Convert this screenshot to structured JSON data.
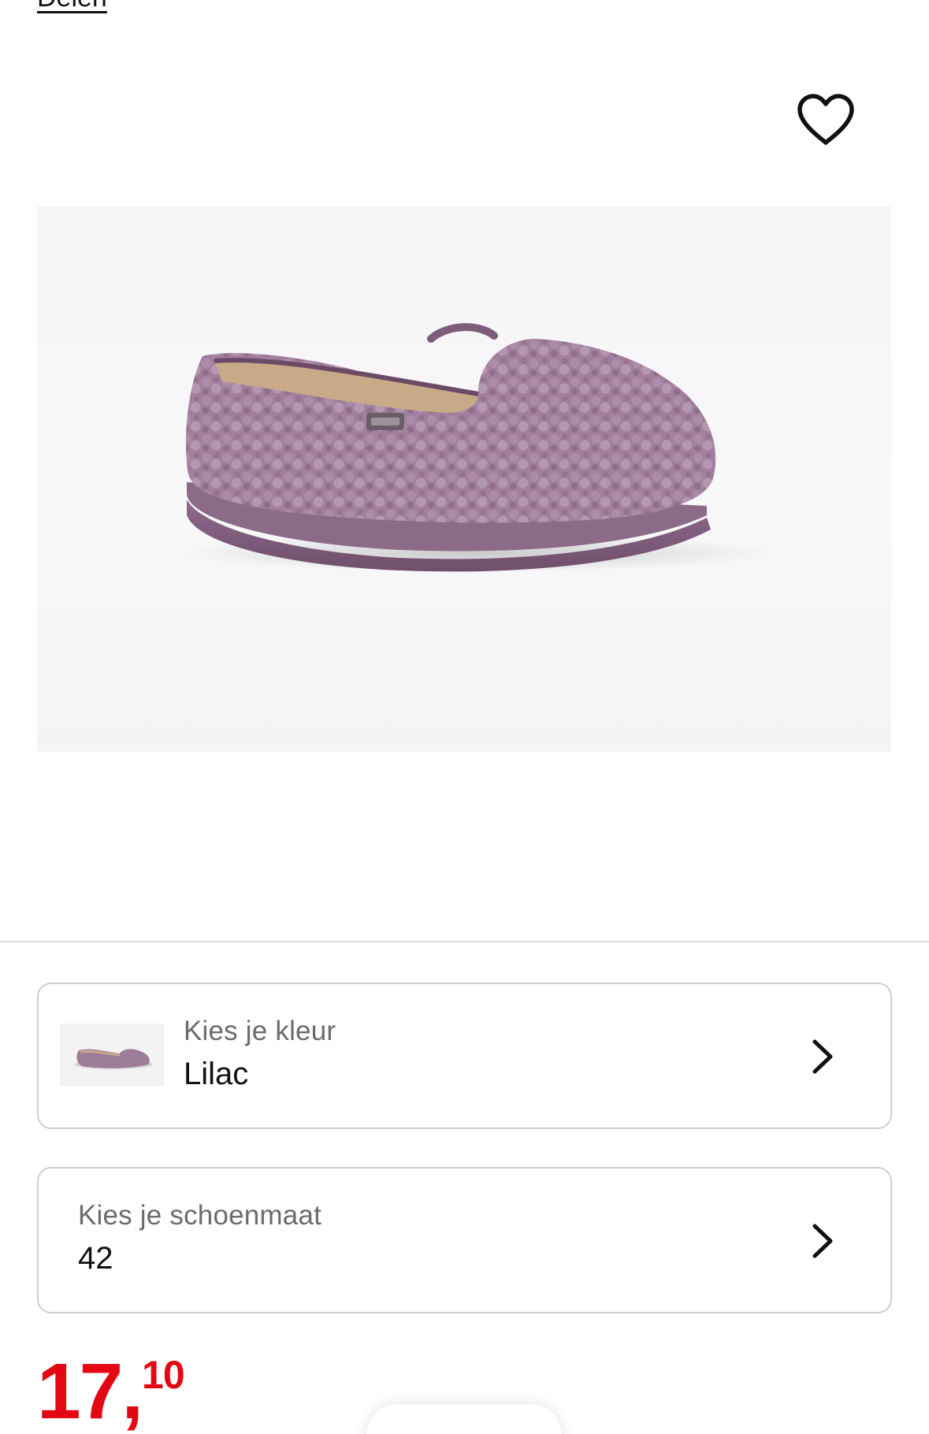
{
  "header": {
    "share_label": "Delen"
  },
  "product": {
    "image_alt": "Lilac teddy pantoffel",
    "favorite_icon": "heart-outline-icon"
  },
  "color_selector": {
    "label": "Kies je kleur",
    "value": "Lilac"
  },
  "size_selector": {
    "label": "Kies je schoenmaat",
    "value": "42"
  },
  "price": {
    "main": "17,",
    "cents": "10"
  },
  "colors": {
    "price_red": "#e30613",
    "border_gray": "#cfcfcf",
    "product_lilac": "#9a7b97"
  }
}
